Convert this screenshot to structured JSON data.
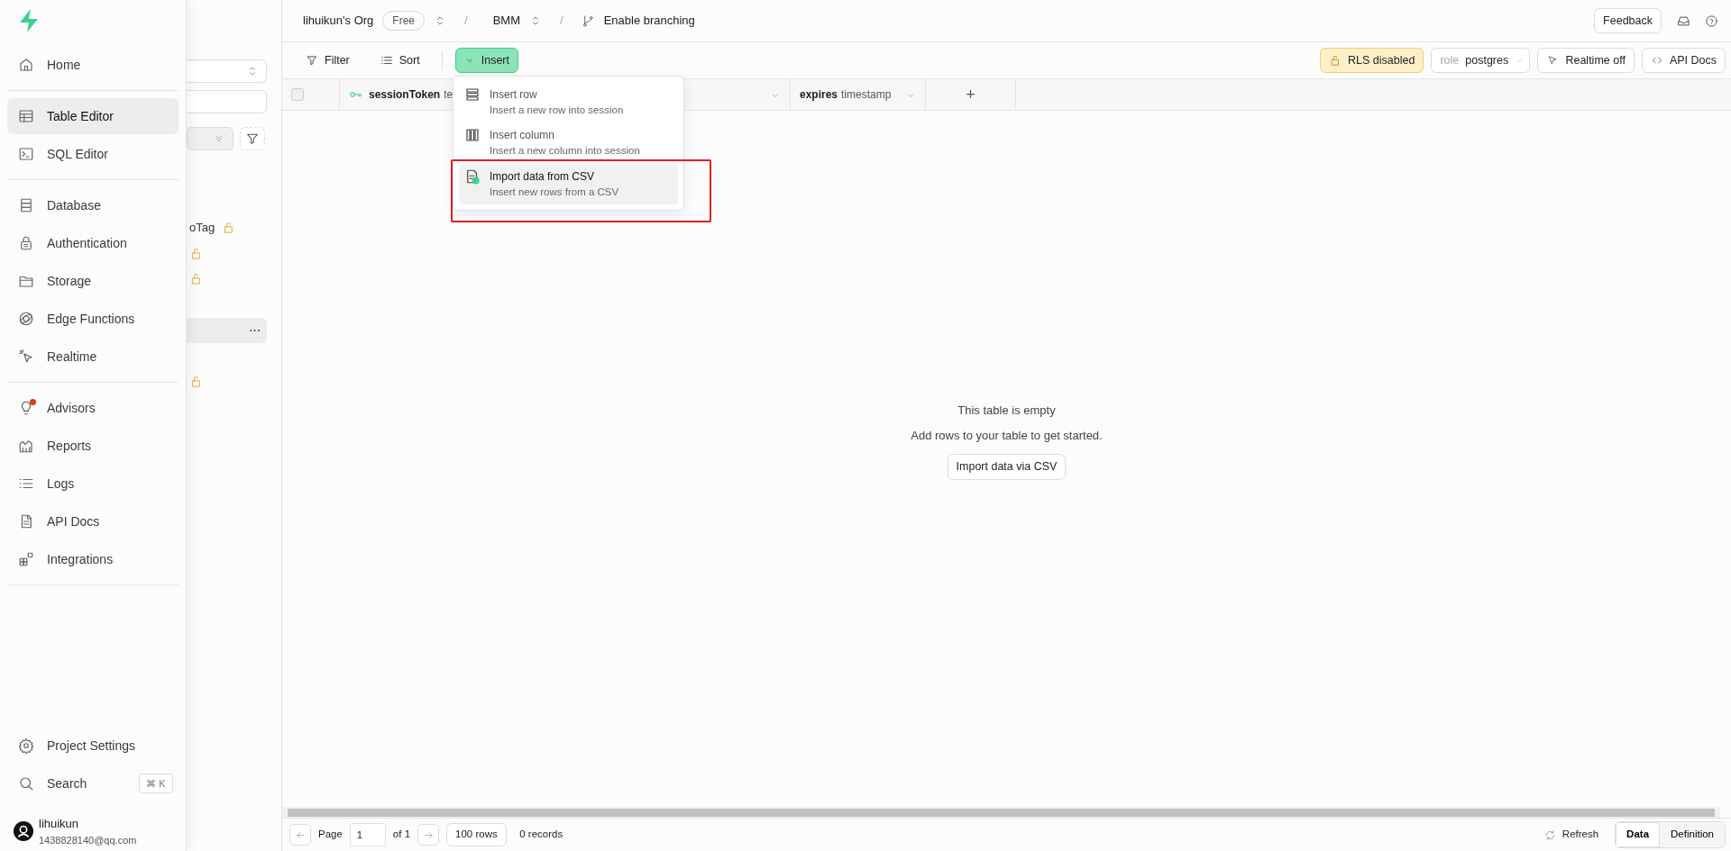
{
  "sidebar": {
    "sections": [
      {
        "items": [
          {
            "label": "Home",
            "selected": false
          }
        ]
      },
      {
        "items": [
          {
            "label": "Table Editor",
            "selected": true
          },
          {
            "label": "SQL Editor",
            "selected": false
          }
        ]
      },
      {
        "items": [
          {
            "label": "Database",
            "selected": false
          },
          {
            "label": "Authentication",
            "selected": false
          },
          {
            "label": "Storage",
            "selected": false
          },
          {
            "label": "Edge Functions",
            "selected": false
          },
          {
            "label": "Realtime",
            "selected": false
          }
        ]
      },
      {
        "items": [
          {
            "label": "Advisors",
            "selected": false,
            "alert": true
          },
          {
            "label": "Reports",
            "selected": false
          },
          {
            "label": "Logs",
            "selected": false
          },
          {
            "label": "API Docs",
            "selected": false
          },
          {
            "label": "Integrations",
            "selected": false
          }
        ]
      }
    ],
    "footer_items": [
      {
        "label": "Project Settings"
      },
      {
        "label": "Search",
        "shortcut": "⌘ K"
      }
    ],
    "user": {
      "name": "lihuikun",
      "email": "1438828140@qq.com"
    }
  },
  "table_list": {
    "rows": [
      {
        "label": "oTag",
        "locked": true,
        "selected": false
      },
      {
        "locked": true,
        "selected": false
      },
      {
        "locked": true,
        "selected": false
      },
      {
        "locked": false,
        "selected": false
      },
      {
        "locked": false,
        "selected": true,
        "menu": "···"
      },
      {
        "locked": false,
        "selected": false
      },
      {
        "locked": true,
        "selected": false
      }
    ]
  },
  "breadcrumb": {
    "org": "lihuikun's Org",
    "plan": "Free",
    "separator": "/",
    "project": "BMM",
    "branching": "Enable branching"
  },
  "header_actions": {
    "feedback": "Feedback"
  },
  "toolbar": {
    "filter": "Filter",
    "sort": "Sort",
    "insert": "Insert",
    "rls": "RLS disabled",
    "role_label": "role",
    "role": "postgres",
    "realtime": "Realtime off",
    "api_docs": "API Docs"
  },
  "insert_menu": [
    {
      "title": "Insert row",
      "description": "Insert a new row into session",
      "selected": false,
      "annotated": false
    },
    {
      "title": "Insert column",
      "description": "Insert a new column into session",
      "selected": false,
      "annotated": false
    },
    {
      "title": "Import data from CSV",
      "description": "Insert new rows from a CSV",
      "selected": true,
      "annotated": true
    }
  ],
  "grid": {
    "select_all_checked": false,
    "columns": [
      {
        "name": "sessionToken",
        "type": "te",
        "primary": true
      },
      {
        "name": "expires",
        "type": "timestamp",
        "primary": false
      }
    ],
    "add_column": "+"
  },
  "empty_state": {
    "title": "This table is empty",
    "message": "Add rows to your table to get started.",
    "action": "Import data via CSV"
  },
  "footer": {
    "page_label": "Page",
    "page": "1",
    "page_of": "of 1",
    "rows": "100 rows",
    "records": "0 records",
    "refresh": "Refresh",
    "views": [
      {
        "label": "Data",
        "selected": true
      },
      {
        "label": "Definition",
        "selected": false
      }
    ]
  }
}
